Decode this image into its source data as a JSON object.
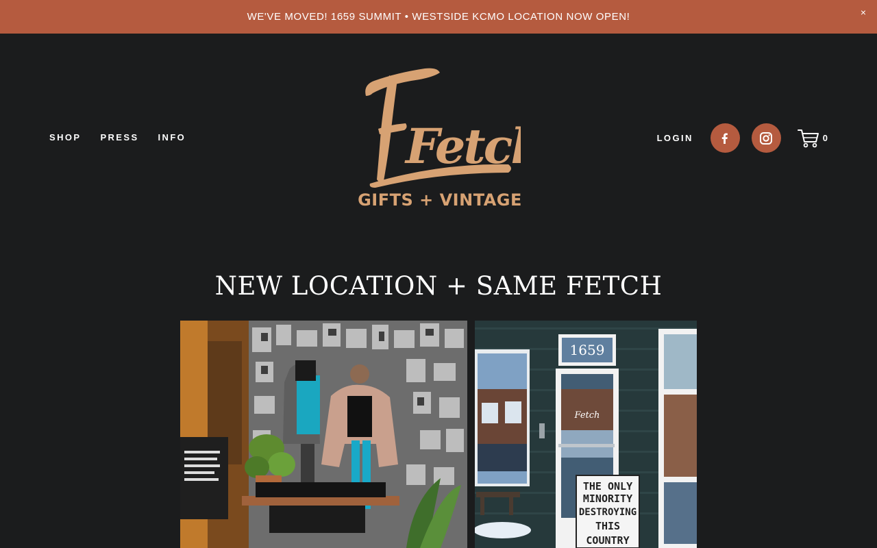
{
  "announcement": {
    "text": "WE'VE MOVED! 1659 SUMMIT • WESTSIDE KCMO LOCATION NOW OPEN!",
    "close_label": "×"
  },
  "nav": {
    "left": [
      {
        "label": "SHOP"
      },
      {
        "label": "PRESS"
      },
      {
        "label": "INFO"
      }
    ],
    "login": "LOGIN",
    "cart_count": "0"
  },
  "logo": {
    "wordmark": "Fetch",
    "tagline": "GIFTS + VINTAGE"
  },
  "social": [
    {
      "icon": "facebook-icon"
    },
    {
      "icon": "instagram-icon"
    }
  ],
  "headline": "NEW LOCATION + SAME FETCH",
  "photo_sign": {
    "address": "1659",
    "door_logo": "Fetch",
    "lines": [
      "THE ONLY",
      "MINORITY",
      "DESTROYING",
      "THIS",
      "COUNTRY"
    ]
  },
  "colors": {
    "background": "#1b1c1d",
    "accent": "#b55b3f",
    "logo": "#d7a273"
  }
}
